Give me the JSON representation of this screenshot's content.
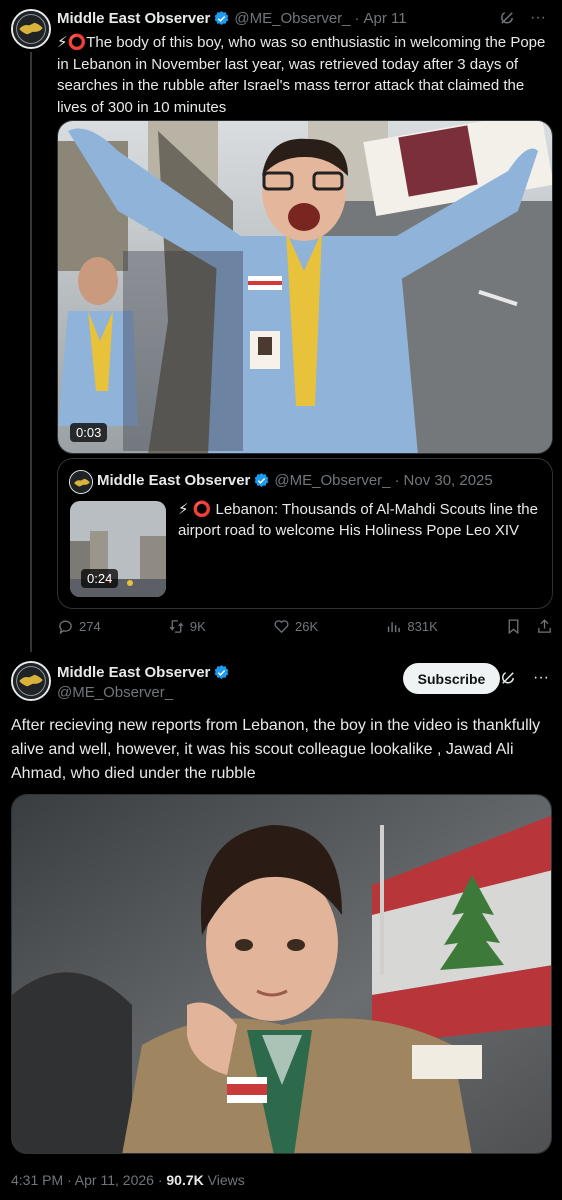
{
  "tweet1": {
    "author": {
      "name": "Middle East Observer",
      "handle": "@ME_Observer_",
      "avatar_icon": "logo-icon"
    },
    "date": "Apr 11",
    "text": "⚡⭕The body of this boy, who was so enthusiastic in welcoming the Pope in Lebanon in November last year,  was retrieved today after 3 days of searches in the rubble after Israel's mass terror attack that claimed the lives of 300 in 10 minutes",
    "video_time": "0:03",
    "quote": {
      "author": {
        "name": "Middle East Observer",
        "handle": "@ME_Observer_"
      },
      "date": "Nov 30, 2025",
      "text": "⚡ ⭕ Lebanon: Thousands of Al-Mahdi Scouts line the airport road to welcome His Holiness Pope Leo XIV",
      "video_time": "0:24"
    },
    "stats": {
      "replies": "274",
      "reposts": "9K",
      "likes": "26K",
      "views": "831K"
    }
  },
  "tweet2": {
    "author": {
      "name": "Middle East Observer",
      "handle": "@ME_Observer_"
    },
    "subscribe_label": "Subscribe",
    "text": "After recieving new reports from Lebanon, the boy in the video is thankfully alive and well, however, it was his scout colleague lookalike , Jawad Ali Ahmad, who died under the rubble",
    "timestamp": "4:31 PM · Apr 11, 2026 · ",
    "views_count": "90.7K",
    "views_label": " Views"
  },
  "colors": {
    "background": "#000000",
    "text": "#e7e9ea",
    "muted": "#71767b",
    "border": "#2f3336",
    "verified": "#1d9bf0"
  }
}
